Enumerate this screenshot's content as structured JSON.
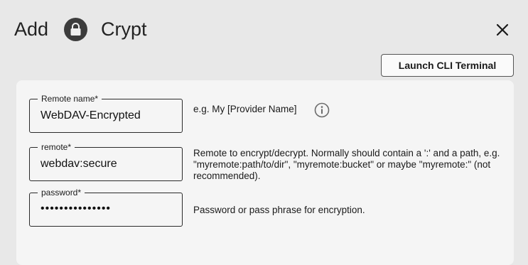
{
  "header": {
    "add_label": "Add",
    "name_label": "Crypt",
    "lock_icon": "lock-icon",
    "close_icon": "close-icon",
    "cli_button_label": "Launch CLI Terminal"
  },
  "form": {
    "fields": [
      {
        "label": "Remote name*",
        "value": "WebDAV-Encrypted",
        "help": "e.g. My [Provider Name]",
        "help_icon": "info-icon"
      },
      {
        "label": "remote*",
        "value": "webdav:secure",
        "help": "Remote to encrypt/decrypt.  Normally should contain a ':' and a path, e.g. \"myremote:path/to/dir\", \"myremote:bucket\" or maybe \"myremote:\" (not recommended)."
      },
      {
        "label": "password*",
        "value": "•••••••••••••••",
        "help": "Password or pass phrase for encryption."
      }
    ]
  },
  "colors": {
    "background": "#e8e8e8",
    "card": "#f5f5f5",
    "lock_badge": "#3c3c3c",
    "border": "#2a2a2a"
  }
}
